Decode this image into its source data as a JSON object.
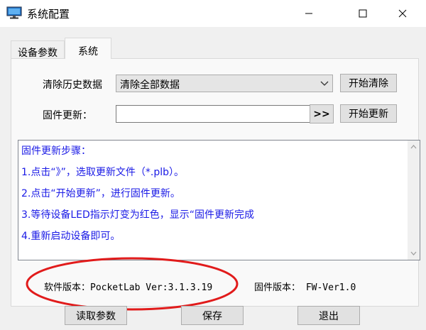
{
  "window": {
    "title": "系统配置",
    "icons": {
      "app": "monitor-icon",
      "minimize": "minimize-icon",
      "maximize": "maximize-icon",
      "close": "close-icon"
    }
  },
  "tabs": [
    {
      "label": "设备参数",
      "active": false
    },
    {
      "label": "系统",
      "active": true
    }
  ],
  "history": {
    "label": "清除历史数据",
    "select_value": "清除全部数据",
    "button": "开始清除"
  },
  "firmware": {
    "label": "固件更新：",
    "input_value": "",
    "browse_button": ">>",
    "update_button": "开始更新"
  },
  "steps": {
    "heading": "固件更新步骤：",
    "items": [
      "1.点击“》”，选取更新文件（*.plb）。",
      "2.点击“开始更新”，进行固件更新。",
      "3.等待设备LED指示灯变为红色，显示“固件更新完成",
      "4.重新启动设备即可。"
    ]
  },
  "info": {
    "software_version": "软件版本：PocketLab Ver:3.1.3.19",
    "firmware_version": "固件版本：  FW-Ver1.0"
  },
  "buttons": {
    "read": "读取参数",
    "save": "保存",
    "exit": "退出"
  },
  "colors": {
    "step_text": "#1a1ae6",
    "highlight_ellipse": "#e11b1b",
    "window_bg": "#f0f0f0",
    "panel_bg": "#f9f9f9"
  }
}
